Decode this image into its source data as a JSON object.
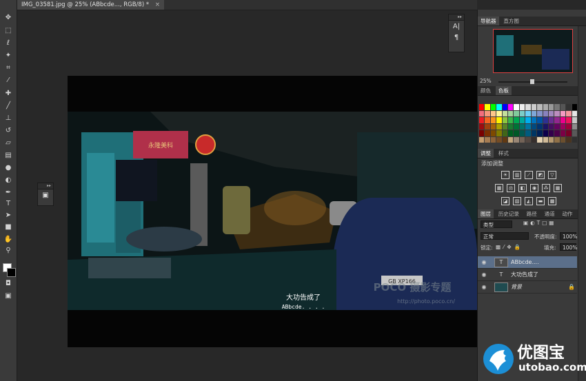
{
  "document": {
    "tab_title": "IMG_03581.jpg @ 25% (ABbcde..., RGB/8) *",
    "close_glyph": "×"
  },
  "photo": {
    "subtitle_line1": "大功告成了",
    "subtitle_line2": "ABbcde. . . .",
    "watermark_brand": "POCO 摄影专题",
    "watermark_url": "http://photo.poco.cn/",
    "plate_text": "GB XP166",
    "sign_text": "永隆美科"
  },
  "toolbar": {
    "tools": [
      "move-tool",
      "marquee-tool",
      "lasso-tool",
      "quick-select-tool",
      "crop-tool",
      "eyedropper-tool",
      "healing-tool",
      "brush-tool",
      "stamp-tool",
      "history-brush-tool",
      "eraser-tool",
      "gradient-tool",
      "blur-tool",
      "dodge-tool",
      "pen-tool",
      "type-tool",
      "path-select-tool",
      "shape-tool",
      "hand-tool",
      "zoom-tool"
    ],
    "foreground_color": "#ffffff",
    "background_color": "#000000"
  },
  "navigator_panel": {
    "tabs": [
      "导航器",
      "直方图"
    ],
    "zoom": "25%"
  },
  "color_panel": {
    "tabs": [
      "颜色",
      "色板"
    ]
  },
  "adjustments_panel": {
    "tabs": [
      "调整",
      "样式"
    ],
    "title": "添加调整"
  },
  "layers_panel": {
    "tabs": [
      "图层",
      "历史记录",
      "路径",
      "通道",
      "动作"
    ],
    "filter_label": "类型",
    "blend_mode": "正常",
    "opacity_label": "不透明度:",
    "opacity_value": "100%",
    "lock_label": "锁定:",
    "fill_label": "填充:",
    "fill_value": "100%",
    "layers": [
      {
        "name": "ABbcde....",
        "kind": "T",
        "selected": true
      },
      {
        "name": "大功告成了",
        "kind": "T",
        "selected": false
      },
      {
        "name": "背景",
        "kind": "img",
        "selected": false
      }
    ]
  },
  "branding": {
    "site_cn": "优图宝",
    "site_url": "utobao.com"
  },
  "colors": {
    "app_bg": "#282828",
    "panel_bg": "#3a3a3a",
    "selection": "#5b6f8a",
    "nav_frame": "#e04040"
  }
}
